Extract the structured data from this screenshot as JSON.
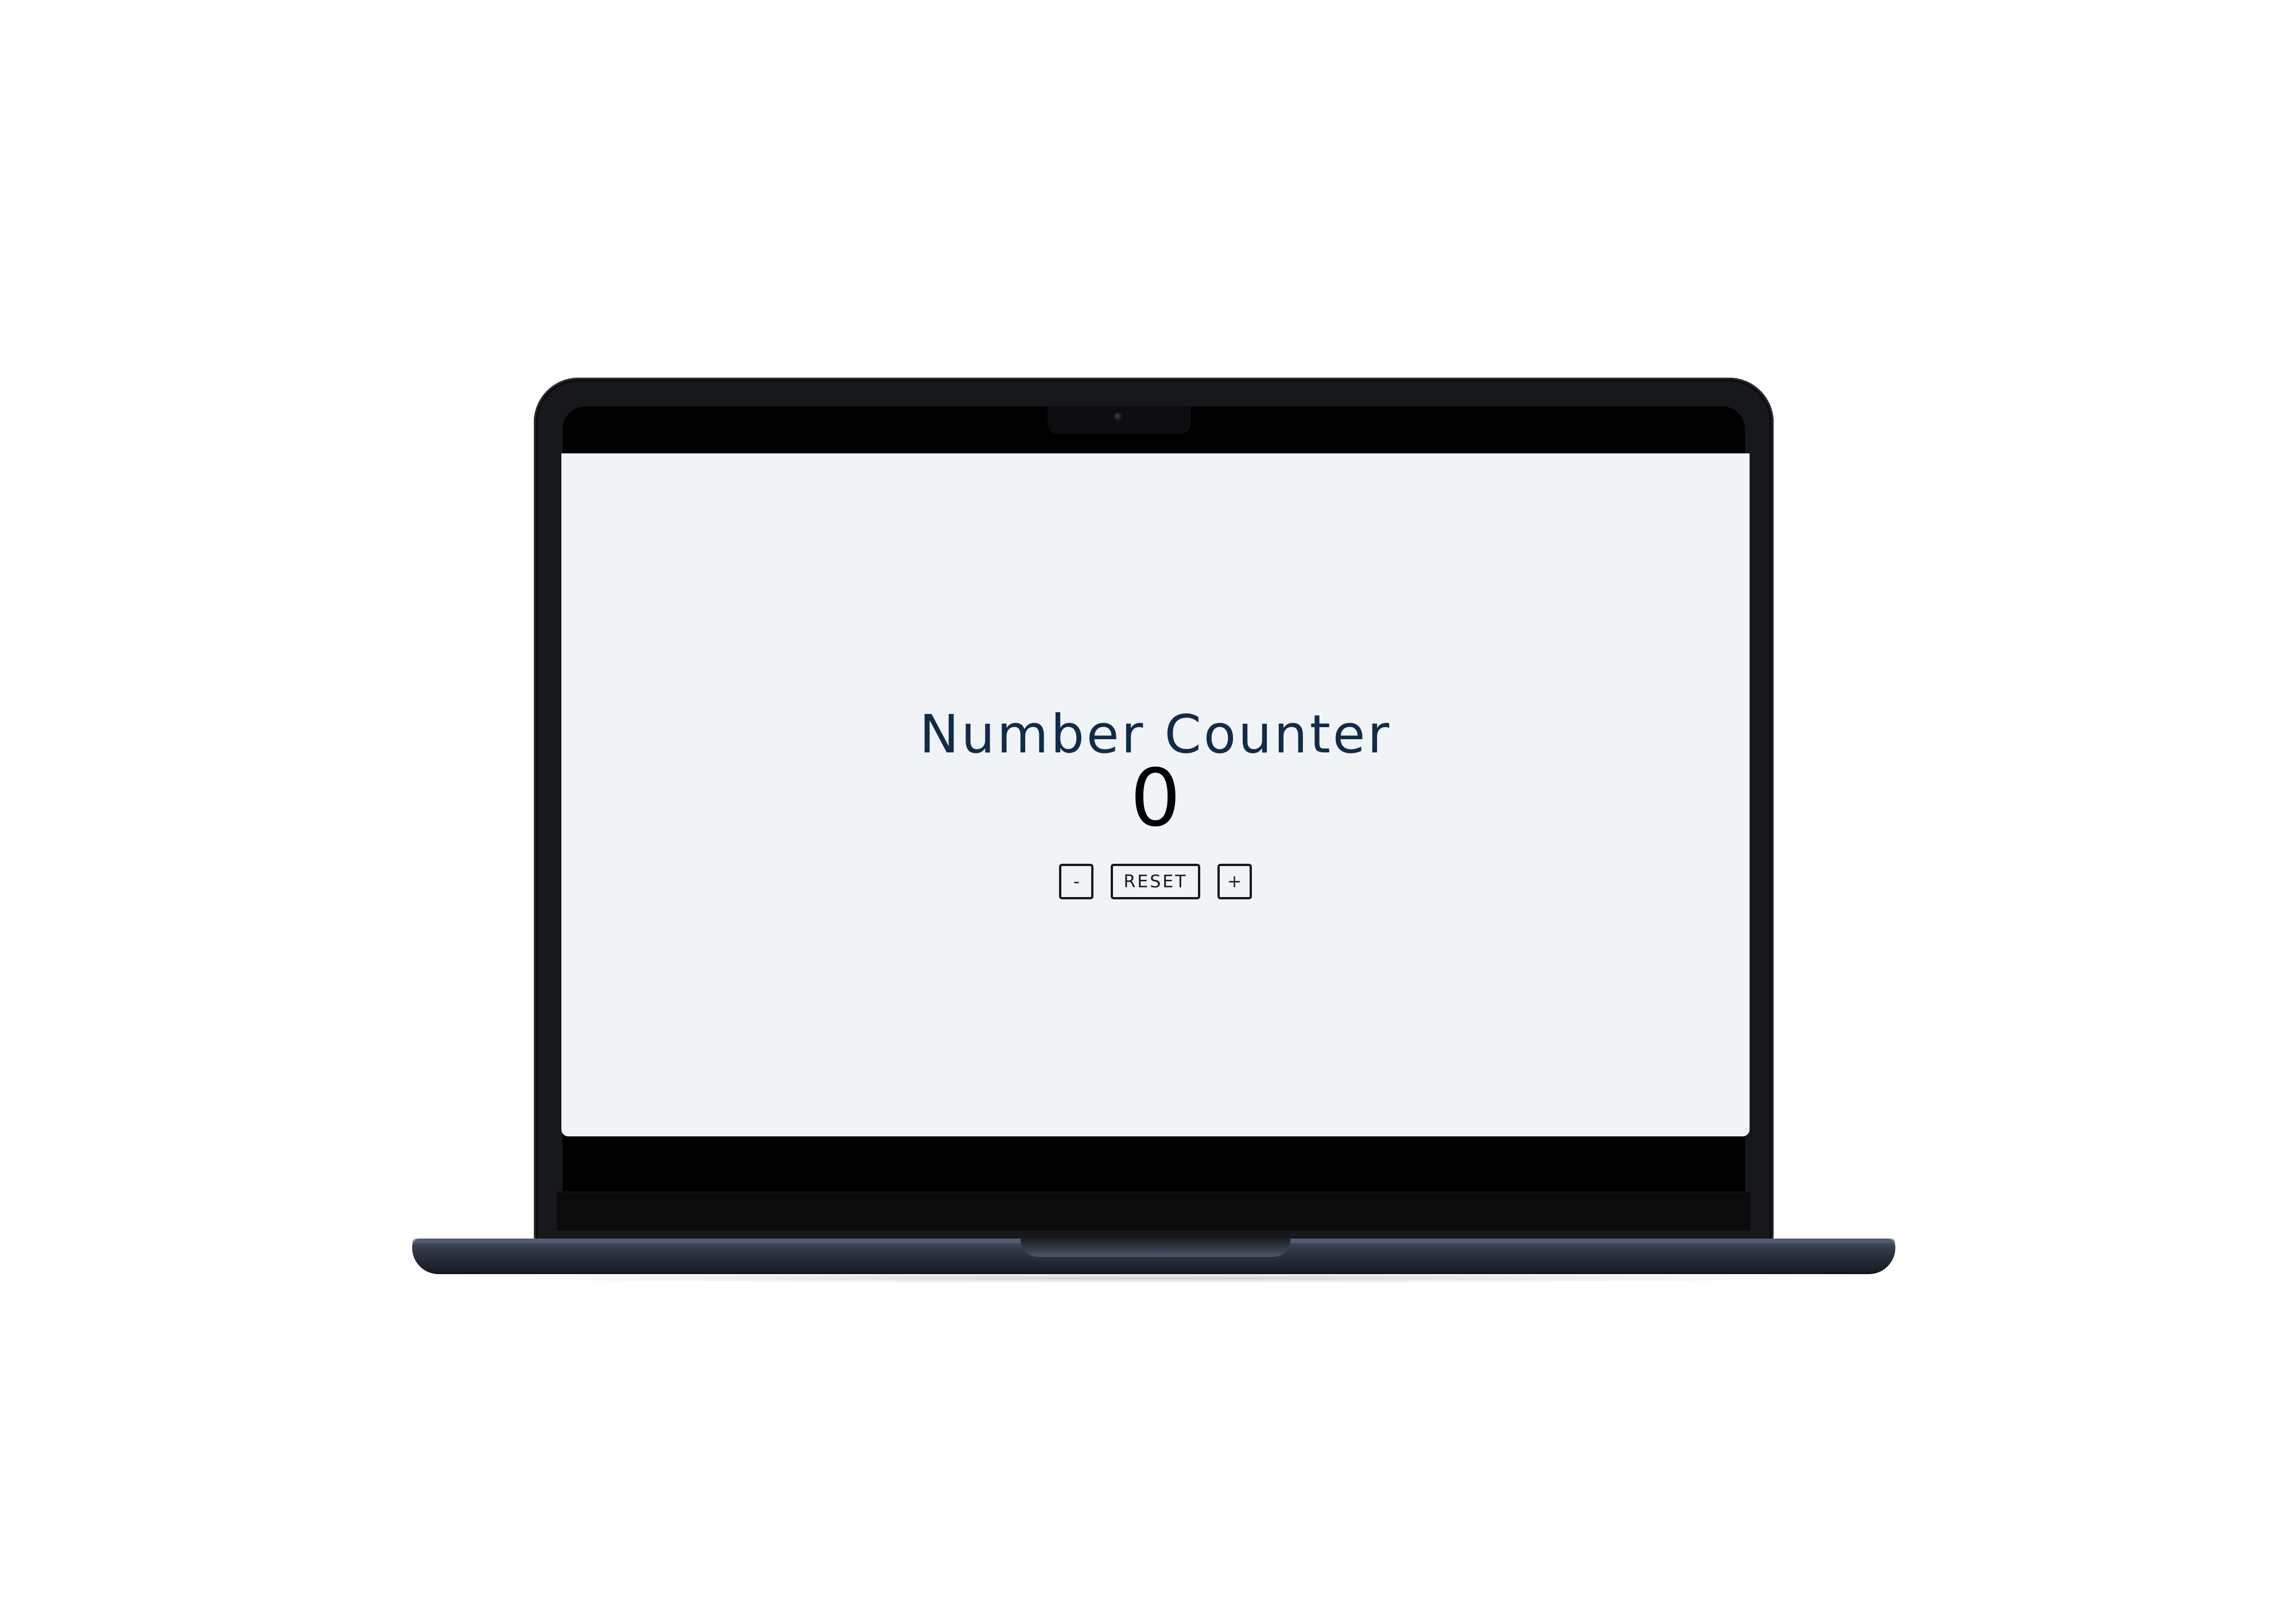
{
  "app": {
    "title": "Number Counter",
    "count": "0"
  },
  "controls": {
    "decrement_label": "-",
    "reset_label": "RESET",
    "increment_label": "+"
  },
  "colors": {
    "page_background": "#ffffff",
    "screen_background": "#f0f4f7",
    "title_color": "#132b47",
    "count_color": "#000000",
    "button_border": "#1a1a1a"
  },
  "icons": [
    "camera-icon"
  ]
}
